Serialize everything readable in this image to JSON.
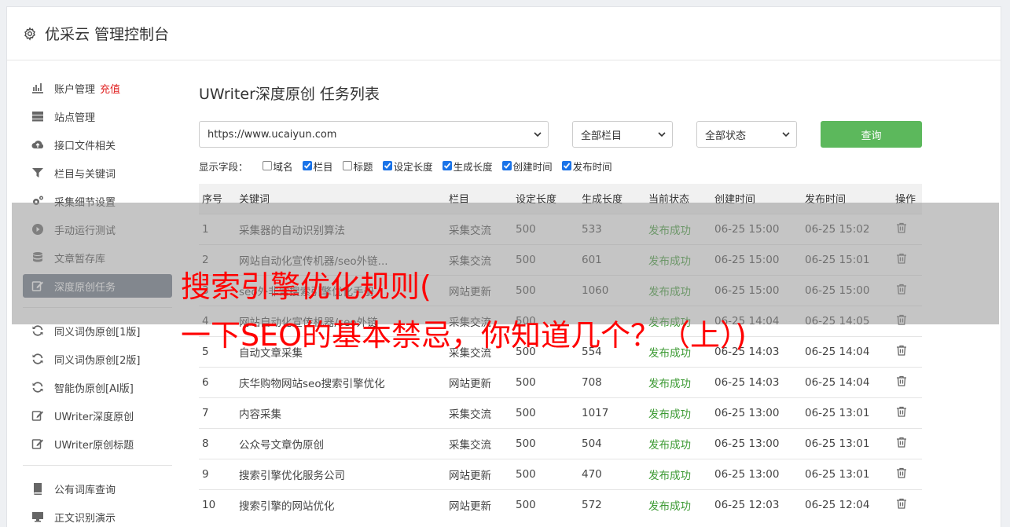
{
  "header": {
    "title": "优采云 管理控制台"
  },
  "sidebar": {
    "recharge": "充值",
    "group1": [
      {
        "label": "账户管理",
        "icon": "bar-chart-icon"
      },
      {
        "label": "站点管理",
        "icon": "server-icon"
      },
      {
        "label": "接口文件相关",
        "icon": "cloud-upload-icon"
      },
      {
        "label": "栏目与关键词",
        "icon": "filter-icon"
      },
      {
        "label": "采集细节设置",
        "icon": "cogs-icon"
      },
      {
        "label": "手动运行测试",
        "icon": "play-circle-icon"
      },
      {
        "label": "文章暂存库",
        "icon": "database-icon"
      },
      {
        "label": "深度原创任务",
        "icon": "edit-icon",
        "active": true
      }
    ],
    "group2": [
      {
        "label": "同义词伪原创[1版]",
        "icon": "refresh-icon"
      },
      {
        "label": "同义词伪原创[2版]",
        "icon": "refresh-icon"
      },
      {
        "label": "智能伪原创[AI版]",
        "icon": "refresh-icon"
      },
      {
        "label": "UWriter深度原创",
        "icon": "edit-icon"
      },
      {
        "label": "UWriter原创标题",
        "icon": "edit-icon"
      }
    ],
    "group3": [
      {
        "label": "公有词库查询",
        "icon": "book-icon"
      },
      {
        "label": "正文识别演示",
        "icon": "monitor-icon"
      }
    ]
  },
  "main": {
    "title": "UWriter深度原创 任务列表",
    "site_select": "https://www.ucaiyun.com",
    "column_select": "全部栏目",
    "status_select": "全部状态",
    "query_label": "查询",
    "fields_label": "显示字段：",
    "fields": [
      {
        "label": "域名",
        "checked": false
      },
      {
        "label": "栏目",
        "checked": true
      },
      {
        "label": "标题",
        "checked": false
      },
      {
        "label": "设定长度",
        "checked": true
      },
      {
        "label": "生成长度",
        "checked": true
      },
      {
        "label": "创建时间",
        "checked": true
      },
      {
        "label": "发布时间",
        "checked": true
      }
    ],
    "table": {
      "headers": [
        "序号",
        "关键词",
        "栏目",
        "设定长度",
        "生成长度",
        "当前状态",
        "创建时间",
        "发布时间",
        "操作"
      ],
      "rows": [
        [
          "1",
          "采集器的自动识别算法",
          "采集交流",
          "500",
          "533",
          "发布成功",
          "06-25 15:00",
          "06-25 15:02"
        ],
        [
          "2",
          "网站自动化宣传机器/seo外链...",
          "采集交流",
          "500",
          "601",
          "发布成功",
          "06-25 15:00",
          "06-25 15:01"
        ],
        [
          "3",
          "seo外非常搜索引擎优化手册",
          "网站更新",
          "500",
          "1060",
          "发布成功",
          "06-25 15:00",
          "06-25 15:00"
        ],
        [
          "4",
          "网站自动化宣传机器/seo外链",
          "采集交流",
          "500",
          "",
          "发布成功",
          "06-25 14:04",
          "06-25 14:05"
        ],
        [
          "5",
          "自动文章采集",
          "采集交流",
          "500",
          "554",
          "发布成功",
          "06-25 14:03",
          "06-25 14:04"
        ],
        [
          "6",
          "庆华购物网站seo搜索引擎优化",
          "网站更新",
          "500",
          "708",
          "发布成功",
          "06-25 14:03",
          "06-25 14:04"
        ],
        [
          "7",
          "内容采集",
          "采集交流",
          "500",
          "1017",
          "发布成功",
          "06-25 13:00",
          "06-25 13:01"
        ],
        [
          "8",
          "公众号文章伪原创",
          "采集交流",
          "500",
          "504",
          "发布成功",
          "06-25 13:00",
          "06-25 13:01"
        ],
        [
          "9",
          "搜索引擎优化服务公司",
          "网站更新",
          "500",
          "470",
          "发布成功",
          "06-25 13:00",
          "06-25 13:01"
        ],
        [
          "10",
          "搜索引擎的网站优化",
          "网站更新",
          "500",
          "572",
          "发布成功",
          "06-25 12:03",
          "06-25 12:04"
        ]
      ]
    }
  },
  "overlay": {
    "line1": "搜索引擎优化规则(",
    "line2": "一下SEO的基本禁忌，你知道几个？（上）)"
  },
  "colors": {
    "accent_green": "#5cb85c",
    "status_green": "#3c9a33",
    "active_nav": "#6a7686",
    "overlay_text": "#ff0000"
  }
}
